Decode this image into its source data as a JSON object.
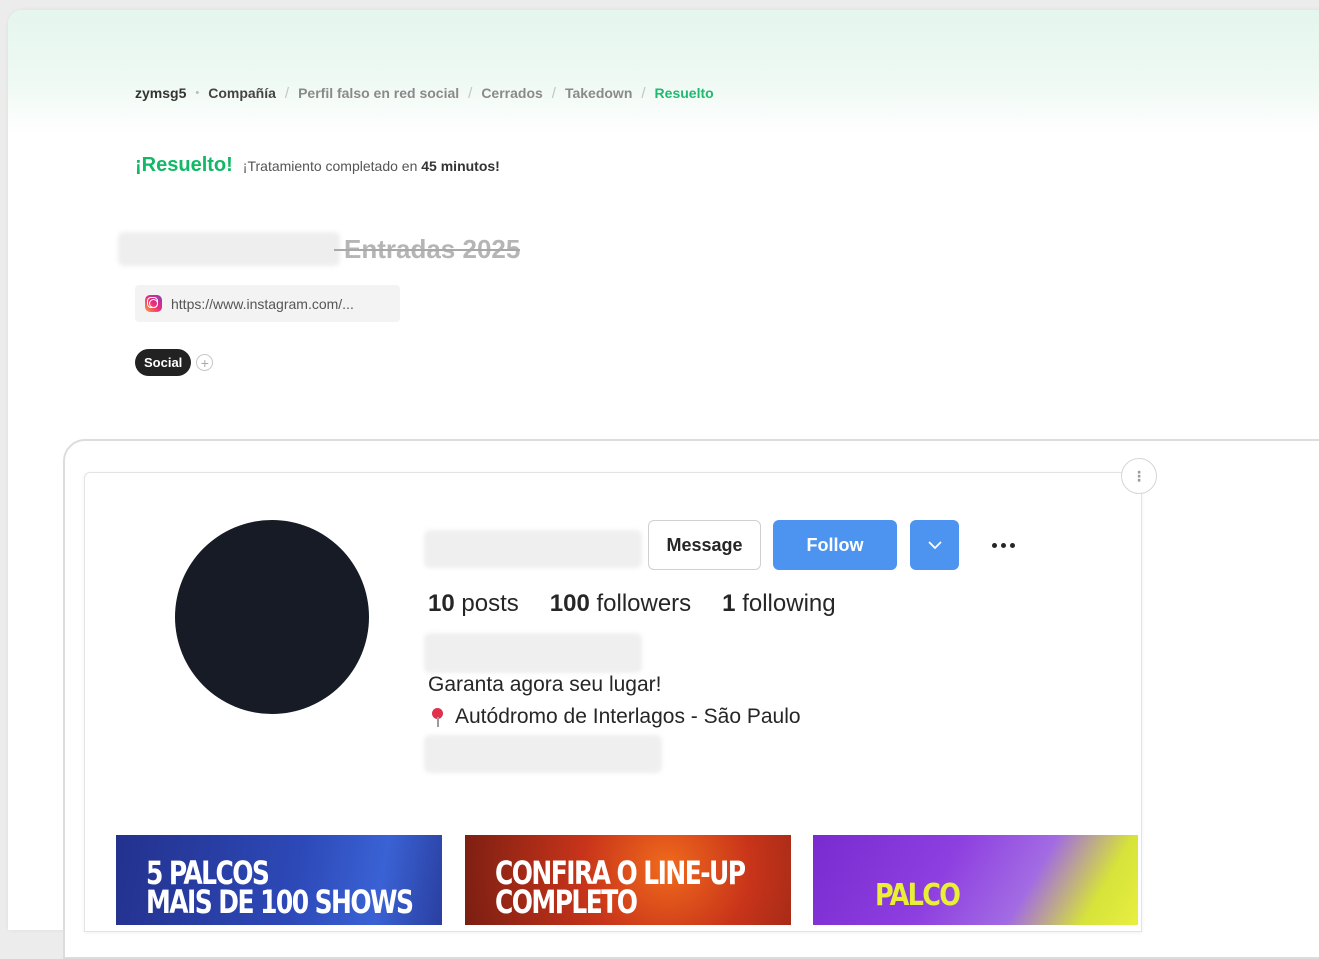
{
  "breadcrumb": {
    "org": "zymsg5",
    "separator_dot": "•",
    "company": "Compañía",
    "separator": "/",
    "items": [
      "Perfil falso en red social",
      "Cerrados",
      "Takedown"
    ],
    "current": "Resuelto"
  },
  "status": {
    "title": "¡Resuelto!",
    "message_prefix": "¡Tratamiento completado en ",
    "duration": "45 minutos!"
  },
  "case": {
    "title": "Entradas 2025",
    "url": "https://www.instagram.com/...",
    "tags": [
      "Social"
    ],
    "add_tag": "+"
  },
  "profile": {
    "buttons": {
      "message": "Message",
      "follow": "Follow",
      "more": "•••",
      "options": "⋮"
    },
    "stats": [
      {
        "value": "10",
        "label": "posts"
      },
      {
        "value": "100",
        "label": "followers"
      },
      {
        "value": "1",
        "label": "following"
      }
    ],
    "bio": {
      "line1": "Garanta agora seu lugar!",
      "line2": "Autódromo de Interlagos - São Paulo"
    },
    "posts": [
      {
        "text_line1": "5 PALCOS",
        "text_line2": "MAIS DE 100 SHOWS"
      },
      {
        "text_line1": "CONFIRA O LINE-UP",
        "text_line2": "COMPLETO"
      },
      {
        "text_line1": "PALCO",
        "text_line2": ""
      }
    ]
  },
  "colors": {
    "accent_green": "#13b866",
    "follow_blue": "#4c94ef",
    "avatar": "#161b26"
  }
}
